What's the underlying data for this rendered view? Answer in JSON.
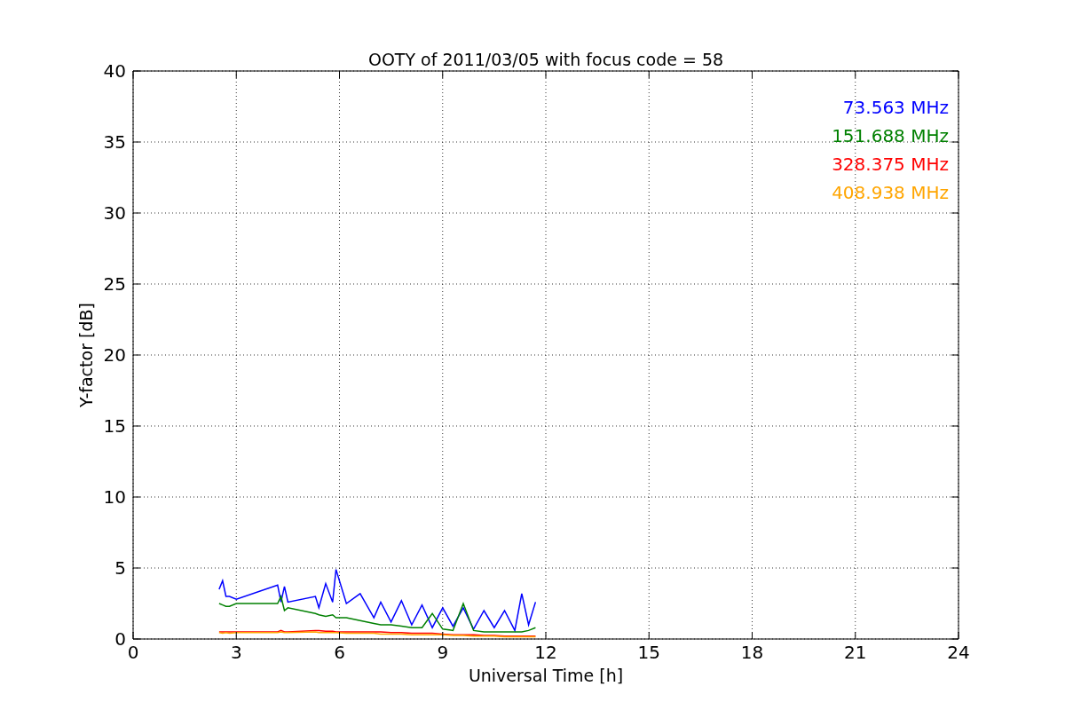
{
  "chart": {
    "chart_data": {
      "type": "line",
      "title": "OOTY of 2011/03/05 with focus code = 58",
      "xlabel": "Universal Time [h]",
      "ylabel": "Y-factor [dB]",
      "x": [
        2.5,
        2.6,
        2.7,
        2.8,
        3.0,
        4.2,
        4.3,
        4.4,
        4.5,
        5.3,
        5.4,
        5.6,
        5.8,
        5.9,
        6.2,
        6.6,
        7.0,
        7.2,
        7.5,
        7.8,
        8.1,
        8.4,
        8.7,
        9.0,
        9.3,
        9.6,
        9.9,
        10.2,
        10.5,
        10.8,
        11.1,
        11.3,
        11.5,
        11.7
      ],
      "series": [
        {
          "name": "73.563 MHz",
          "color": "#0000ff",
          "values": [
            3.5,
            4.1,
            3.0,
            3.0,
            2.8,
            3.8,
            2.6,
            3.7,
            2.6,
            3.0,
            2.2,
            3.9,
            2.6,
            4.9,
            2.5,
            3.2,
            1.5,
            2.6,
            1.2,
            2.7,
            1.0,
            2.4,
            0.8,
            2.2,
            0.9,
            2.2,
            0.7,
            2.0,
            0.8,
            2.0,
            0.6,
            3.2,
            1.0,
            2.6
          ]
        },
        {
          "name": "151.688 MHz",
          "color": "#008000",
          "values": [
            2.5,
            2.4,
            2.3,
            2.3,
            2.5,
            2.5,
            3.0,
            2.0,
            2.2,
            1.8,
            1.7,
            1.6,
            1.7,
            1.5,
            1.5,
            1.3,
            1.1,
            1.0,
            1.0,
            0.9,
            0.8,
            0.8,
            1.8,
            0.7,
            0.6,
            2.5,
            0.6,
            0.5,
            0.5,
            0.5,
            0.5,
            0.5,
            0.6,
            0.8
          ]
        },
        {
          "name": "328.375 MHz",
          "color": "#ff0000",
          "values": [
            0.5,
            0.5,
            0.5,
            0.5,
            0.5,
            0.5,
            0.6,
            0.5,
            0.5,
            0.6,
            0.6,
            0.55,
            0.55,
            0.5,
            0.5,
            0.5,
            0.5,
            0.5,
            0.45,
            0.45,
            0.4,
            0.4,
            0.4,
            0.35,
            0.3,
            0.3,
            0.3,
            0.25,
            0.25,
            0.2,
            0.2,
            0.2,
            0.2,
            0.2
          ]
        },
        {
          "name": "408.938 MHz",
          "color": "#ffa500",
          "values": [
            0.45,
            0.4,
            0.45,
            0.4,
            0.45,
            0.45,
            0.5,
            0.45,
            0.45,
            0.5,
            0.45,
            0.45,
            0.45,
            0.45,
            0.4,
            0.4,
            0.4,
            0.35,
            0.35,
            0.35,
            0.3,
            0.3,
            0.3,
            0.3,
            0.25,
            0.25,
            0.2,
            0.2,
            0.2,
            0.15,
            0.15,
            0.15,
            0.15,
            0.15
          ]
        }
      ],
      "grid": true,
      "xlim": [
        0,
        24
      ],
      "ylim": [
        0,
        40
      ],
      "xticks": [
        0,
        3,
        6,
        9,
        12,
        15,
        18,
        21,
        24
      ],
      "yticks": [
        0,
        5,
        10,
        15,
        20,
        25,
        30,
        35,
        40
      ]
    }
  }
}
